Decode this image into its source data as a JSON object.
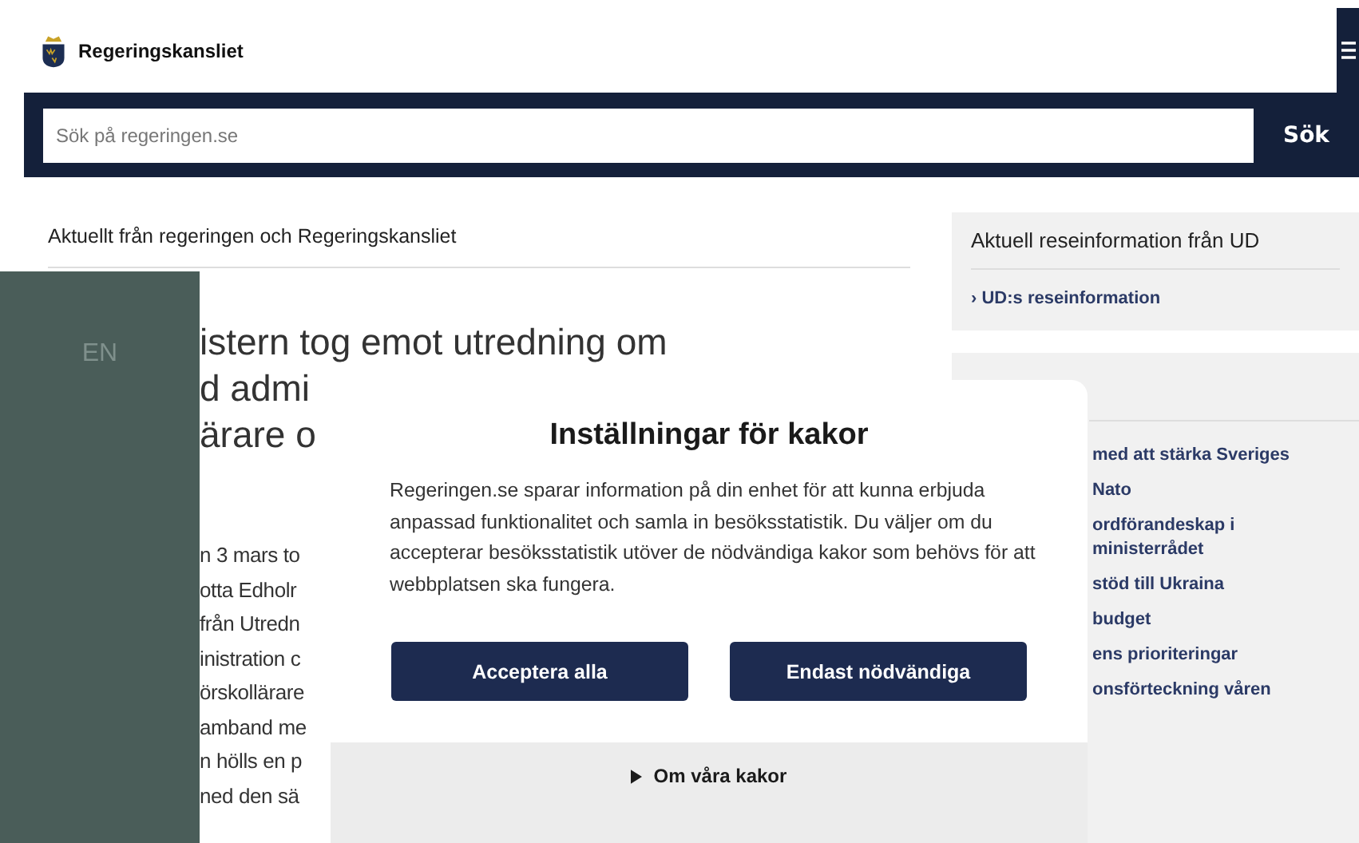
{
  "header": {
    "logo_text": "Regeringskansliet"
  },
  "search": {
    "placeholder": "Sök på regeringen.se",
    "button": "Sök"
  },
  "main": {
    "section_title": "Aktuellt från regeringen och Regeringskansliet",
    "headline_lines": [
      "istern tog emot utredning om",
      "d admi",
      "ärare o"
    ],
    "body_lines": [
      "n 3 mars to",
      "otta Edholr",
      "från Utredn",
      "inistration c",
      "örskollärare",
      "amband me",
      "n hölls en p",
      "ned den sä"
    ]
  },
  "sidebar": {
    "travel_box": {
      "title": "Aktuell reseinformation från UD",
      "link": "› UD:s reseinformation"
    },
    "links": [
      [
        "med att stärka Sveriges"
      ],
      [
        "Nato"
      ],
      [
        "ordförandeskap i",
        "ministerrådet"
      ],
      [
        "stöd till Ukraina"
      ],
      [
        "budget"
      ],
      [
        "ens prioriteringar"
      ],
      [
        "onsförteckning våren"
      ]
    ]
  },
  "language_panel": {
    "label": "EN"
  },
  "cookie_dialog": {
    "title": "Inställningar för kakor",
    "text": "Regeringen.se sparar information på din enhet för att kunna erbjuda anpassad funktionalitet och samla in besöksstatistik. Du väljer om du accepterar besöksstatistik utöver de nödvändiga kakor som behövs för att webbplatsen ska fungera.",
    "buttons": [
      "Acceptera alla",
      "Endast nödvändiga"
    ],
    "details_toggle": {
      "label": "Om våra kakor",
      "expanded": false
    }
  }
}
